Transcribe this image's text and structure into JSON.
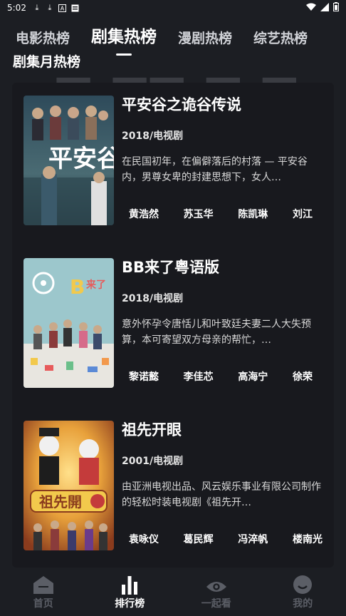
{
  "status_bar": {
    "time": "5:02",
    "icons_left": [
      "download-icon",
      "download-icon",
      "app-icon",
      "app-icon"
    ],
    "icons_right": [
      "wifi-icon",
      "signal-icon",
      "battery-icon"
    ]
  },
  "tabs": [
    {
      "label": "电影热榜",
      "active": false
    },
    {
      "label": "剧集热榜",
      "active": true
    },
    {
      "label": "漫剧热榜",
      "active": false
    },
    {
      "label": "综艺热榜",
      "active": false
    }
  ],
  "section_title": "剧集月热榜",
  "items": [
    {
      "title": "平安谷之诡谷传说",
      "meta": "2018/电视剧",
      "desc": "在民国初年，在偏僻落后的村落 — 平安谷内，男尊女卑的封建思想下，女人…",
      "cast": [
        "黄浩然",
        "苏玉华",
        "陈凯琳",
        "刘江"
      ]
    },
    {
      "title": "BB来了粤语版",
      "meta": "2018/电视剧",
      "desc": "意外怀孕令唐恬儿和叶致廷夫妻二人大失预算，本可寄望双方母亲的帮忙，…",
      "cast": [
        "黎诺懿",
        "李佳芯",
        "高海宁",
        "徐荣"
      ]
    },
    {
      "title": "祖先开眼",
      "meta": "2001/电视剧",
      "desc": "由亚洲电视出品、风云娱乐事业有限公司制作的轻松时装电视剧《祖先开…",
      "cast": [
        "袁咏仪",
        "葛民辉",
        "冯淬帆",
        "楼南光"
      ]
    }
  ],
  "bottom_nav": [
    {
      "label": "首页",
      "icon": "home-icon",
      "active": false
    },
    {
      "label": "排行榜",
      "icon": "ranking-icon",
      "active": true
    },
    {
      "label": "一起看",
      "icon": "eye-icon",
      "active": false
    },
    {
      "label": "我的",
      "icon": "profile-icon",
      "active": false
    }
  ]
}
